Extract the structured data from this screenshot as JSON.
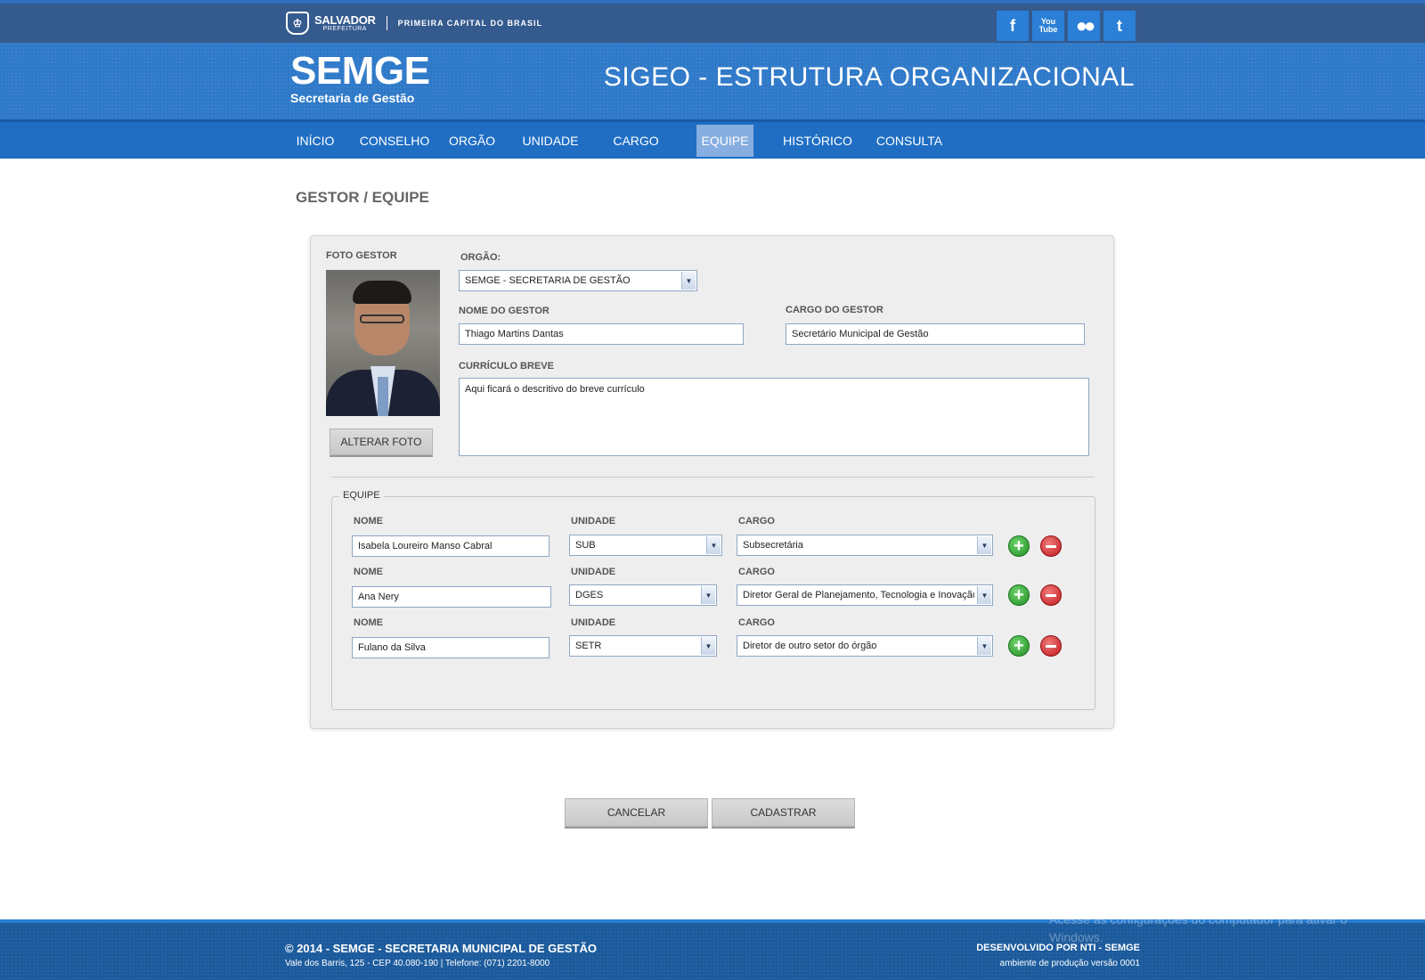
{
  "topbar": {
    "city": "SALVADOR",
    "city_sub": "PREFEITURA",
    "slogan": "PRIMEIRA CAPITAL DO BRASIL",
    "social": [
      {
        "label": "f",
        "icon": "facebook-icon"
      },
      {
        "label": "You Tube",
        "icon": "youtube-icon"
      },
      {
        "label": "●●",
        "icon": "flickr-icon"
      },
      {
        "label": "t",
        "icon": "twitter-icon"
      }
    ]
  },
  "header": {
    "brand": "SEMGE",
    "brand_sub": "Secretaria de Gestão",
    "system_title": "SIGEO - ESTRUTURA ORGANIZACIONAL"
  },
  "nav": {
    "items": [
      "INÍCIO",
      "CONSELHO",
      "ORGÃO",
      "UNIDADE",
      "CARGO",
      "EQUIPE",
      "HISTÓRICO",
      "CONSULTA"
    ],
    "active": "EQUIPE"
  },
  "page": {
    "title": "GESTOR / EQUIPE"
  },
  "form": {
    "photo_label": "FOTO GESTOR",
    "change_photo": "ALTERAR FOTO",
    "orgao_label": "ORGÃO:",
    "orgao_value": "SEMGE - SECRETARIA DE GESTÃO",
    "nome_gestor_label": "NOME DO GESTOR",
    "nome_gestor_value": "Thiago Martins Dantas",
    "cargo_gestor_label": "CARGO DO GESTOR",
    "cargo_gestor_value": "Secretário Municipal de Gestão",
    "curriculo_label": "CURRÍCULO BREVE",
    "curriculo_value": "Aqui ficará o descritivo do breve currículo"
  },
  "equipe": {
    "legend": "EQUIPE",
    "nome_label": "NOME",
    "unidade_label": "UNIDADE",
    "cargo_label": "CARGO",
    "rows": [
      {
        "nome": "Isabela Loureiro Manso Cabral",
        "unidade": "SUB",
        "cargo": "Subsecretária"
      },
      {
        "nome": "Ana Nery",
        "unidade": "DGES",
        "cargo": "Diretor Geral de Planejamento, Tecnologia e Inovação"
      },
      {
        "nome": "Fulano da Silva",
        "unidade": "SETR",
        "cargo": "Diretor de outro setor do órgão"
      }
    ]
  },
  "actions": {
    "cancel": "CANCELAR",
    "submit": "CADASTRAR"
  },
  "footer": {
    "copyright": "© 2014 - SEMGE - SECRETARIA MUNICIPAL DE GESTÃO",
    "address": "Vale dos Barris, 125 - CEP 40.080-190 | Telefone: (071) 2201-8000",
    "developer": "DESENVOLVIDO POR NTI - SEMGE",
    "version": "ambiente de produção versão 0001"
  },
  "watermark": {
    "line1": "Acesse as configurações do computador para ativar o",
    "line2": "Windows."
  },
  "colors": {
    "topbar": "#345a8e",
    "header": "#2f79c9",
    "nav": "#1f6ec4",
    "nav_active": "#86aee0",
    "footer": "#1b5a9c",
    "add": "#1f8f23",
    "remove": "#c0171b"
  }
}
